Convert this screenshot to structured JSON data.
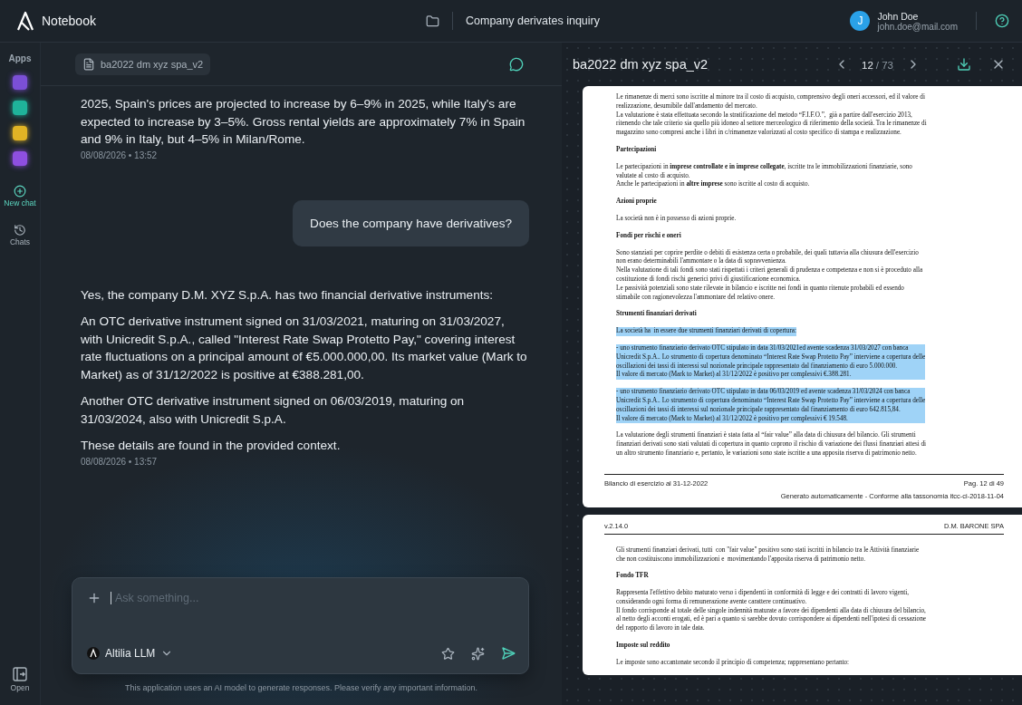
{
  "app": {
    "title": "Notebook"
  },
  "header": {
    "chat_title": "Company derivates inquiry",
    "user": {
      "initial": "J",
      "name": "John Doe",
      "email": "john.doe@mail.com"
    }
  },
  "sidebar": {
    "apps_label": "Apps",
    "items": [
      {
        "label": "New chat",
        "kind": "new"
      },
      {
        "label": "Chats",
        "kind": "history"
      }
    ],
    "open_label": "Open"
  },
  "chat": {
    "document_chip": "ba2022 dm xyz spa_v2",
    "messages": [
      {
        "kind": "assistant",
        "paragraphs": [
          "2025, Spain's prices are projected to increase by 6–9% in 2025, while Italy's are expected to increase by 3–5%. Gross rental yields are approximately 7% in Spain and 9% in Italy, but 4–5% in Milan/Rome."
        ],
        "time": "08/08/2026 • 13:52"
      },
      {
        "kind": "user",
        "paragraphs": [
          "Does the company have derivatives?"
        ]
      },
      {
        "kind": "assistant",
        "paragraphs": [
          "Yes, the company D.M. XYZ S.p.A. has two financial derivative instruments:",
          "An OTC derivative instrument signed on 31/03/2021, maturing on 31/03/2027, with Unicredit S.p.A., called \"Interest Rate Swap Protetto Pay,\" covering interest rate fluctuations on a principal amount of €5.000.000,00. Its market value (Mark to Market) as of 31/12/2022 is positive at €388.281,00.",
          "Another OTC derivative instrument signed on 06/03/2019, maturing on 31/03/2024, also with Unicredit S.p.A.",
          "These details are found in the provided context."
        ],
        "time": "08/08/2026 • 13:57"
      }
    ],
    "input": {
      "placeholder": "Ask something...",
      "model": "Altilia LLM"
    },
    "disclaimer": "This application uses an AI model to generate responses. Please verify any important information."
  },
  "viewer": {
    "title": "ba2022 dm xyz spa_v2",
    "page": "12",
    "total": "/ 73",
    "pages": [
      {
        "blocks": [
          {
            "kind": "p",
            "highlighted": false,
            "text": "Le rimanenze di merci sono iscritte al minore tra il costo di acquisto, comprensivo degli oneri accessori, ed il valore di\nrealizzazione, desumibile dall'andamento del mercato.\nLa valutazione è stata effettuata secondo la stratificazione del metodo “F.I.F.O.”,  già a partire dall'esercizio 2013,\nritenendo che tale criterio sia quello più idoneo al settore merceologico di riferimento della società. Tra le rimanenze di\nmagazzino sono compresi anche i libri in c/rimanenze valorizzati al costo specifico di stampa e realizzazione."
          },
          {
            "kind": "h",
            "highlighted": false,
            "text": "Partecipazioni"
          },
          {
            "kind": "p",
            "highlighted": false,
            "text": "Le partecipazioni in **imprese controllate e in imprese collegate**, iscritte tra le immobilizzazioni finanziarie, sono\nvalutate al costo di acquisto.\nAnche le partecipazioni in **altre imprese** sono iscritte al costo di acquisto."
          },
          {
            "kind": "h",
            "highlighted": false,
            "text": "Azioni proprie"
          },
          {
            "kind": "p",
            "highlighted": false,
            "text": "La società non è in possesso di azioni proprie."
          },
          {
            "kind": "h",
            "highlighted": false,
            "text": "Fondi per rischi e oneri"
          },
          {
            "kind": "p",
            "highlighted": false,
            "text": "Sono stanziati per coprire perdite o debiti di esistenza certa o probabile, dei quali tuttavia alla chiusura dell'esercizio\nnon erano determinabili l'ammontare o la data di sopravvenienza.\nNella valutazione di tali fondi sono stati rispettati i criteri generali di prudenza e competenza e non si è proceduto alla\ncostituzione di fondi rischi generici privi di giustificazione economica.\nLe passività potenziali sono state rilevate in bilancio e iscritte nei fondi in quanto ritenute probabili ed essendo\nstimabile con ragionevolezza l'ammontare del relativo onere."
          },
          {
            "kind": "h",
            "highlighted": false,
            "text": "Strumenti finanziari derivati"
          },
          {
            "kind": "p",
            "highlighted": true,
            "text": "La società ha  in essere due strumenti finanziari derivati di copertura:"
          },
          {
            "kind": "p",
            "highlighted": true,
            "text": "- uno strumento finanziario derivato OTC stipulato in data 31/03/2021ed avente scadenza 31/03/2027 con banca\nUnicredit S.p.A.. Lo strumento di copertura denominato “Interest Rate Swap Protetto Pay” interviene a copertura delle\noscillazioni dei tassi di interessi sul nozionale principale rappresentato dal finanziamento di euro 5.000.000.\nIl valore di mercato (Mark to Market) al 31/12/2022 è positivo per complessivi €.388.281."
          },
          {
            "kind": "p",
            "highlighted": true,
            "text": "- uno strumento finanziario derivato OTC stipulato in data 06/03/2019 ed avente scadenza 31/03/2024 con banca\nUnicredit S.p.A.. Lo strumento di copertura denominato “Interest Rate Swap Protetto Pay” interviene a copertura delle\noscillazioni dei tassi di interessi sul nozionale principale rappresentato dal finanziamento di euro 642.815,84.\nIl valore di mercato (Mark to Market) al 31/12/2022 è positivo per complessivi € 19.548."
          },
          {
            "kind": "p",
            "highlighted": false,
            "text": "La valutazione degli strumenti finanziari è stata fatta al “fair value” alla data di chiusura del bilancio. Gli strumenti\nfinanziari derivati sono stati valutati di copertura in quanto coprono il rischio di variazione dei flussi finanziari attesi di\nun altro strumento finanziario e, pertanto, le variazioni sono state iscritte a una apposita riserva di patrimonio netto."
          }
        ],
        "footer_left": "Bilancio di esercizio al 31-12-2022",
        "footer_right": "Pag. 12 di 49",
        "footer_note": "Generato automaticamente - Conforme alla tassonomia itcc-ci-2018-11-04"
      },
      {
        "header_left": "v.2.14.0",
        "header_right": "D.M. BARONE SPA",
        "blocks": [
          {
            "kind": "p",
            "highlighted": false,
            "text": "Gli strumenti finanziari derivati, tutti  con \"fair value\" positivo sono stati iscritti in bilancio tra le Attività finanziarie\nche non costituiscono immobilizzazioni e  movimentando l'apposita riserva di patrimonio netto."
          },
          {
            "kind": "h",
            "highlighted": false,
            "text": "Fondo TFR"
          },
          {
            "kind": "p",
            "highlighted": false,
            "text": "Rappresenta l'effettivo debito maturato verso i dipendenti in conformità di legge e dei contratti di lavoro vigenti,\nconsiderando ogni forma di remunerazione avente carattere continuativo.\nIl fondo corrisponde al totale delle singole indennità maturate a favore dei dipendenti alla data di chiusura del bilancio,\nal netto degli acconti erogati, ed è pari a quanto si sarebbe dovuto corrispondere ai dipendenti nell'ipotesi di cessazione\ndel rapporto di lavoro in tale data."
          },
          {
            "kind": "h",
            "highlighted": false,
            "text": "Imposte sul reddito"
          },
          {
            "kind": "p",
            "highlighted": false,
            "text": "Le imposte sono accantonate secondo il principio di competenza; rappresentano pertanto:"
          }
        ]
      }
    ]
  }
}
